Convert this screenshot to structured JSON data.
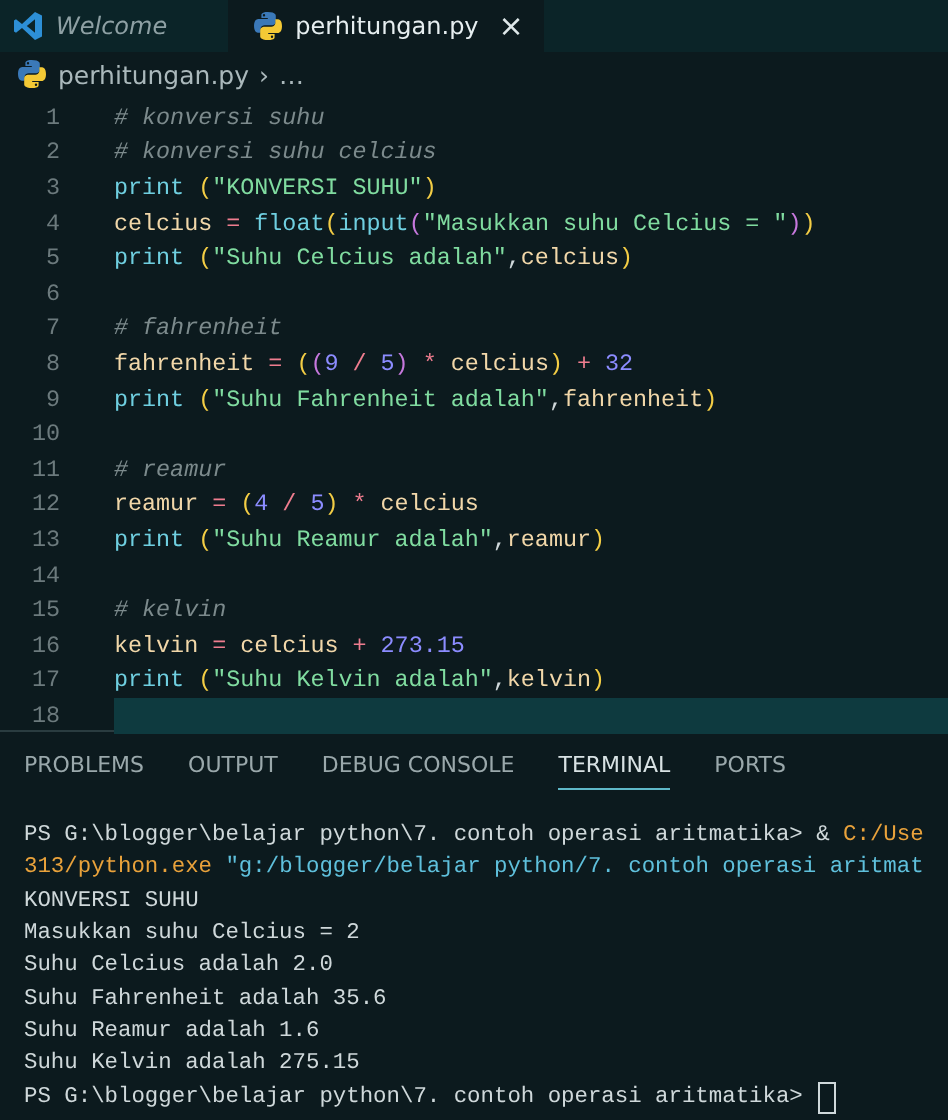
{
  "editor_tabs": [
    {
      "label": "Welcome",
      "kind": "vscode",
      "preview": true,
      "selected": false
    },
    {
      "label": "perhitungan.py",
      "kind": "python",
      "preview": false,
      "selected": true,
      "close": "×"
    }
  ],
  "breadcrumb": {
    "file": "perhitungan.py",
    "separator": "›",
    "more": "…"
  },
  "code_lines": [
    {
      "number": "1",
      "current": false,
      "tokens": [
        {
          "kind": "comment",
          "text": "# konversi suhu"
        }
      ]
    },
    {
      "number": "2",
      "current": false,
      "tokens": [
        {
          "kind": "comment",
          "text": "# konversi suhu celcius"
        }
      ]
    },
    {
      "number": "3",
      "current": false,
      "tokens": [
        {
          "kind": "func",
          "text": "print"
        },
        {
          "kind": "paren1",
          "text": " ("
        },
        {
          "kind": "str",
          "text": "\"KONVERSI SUHU\""
        },
        {
          "kind": "paren1",
          "text": ")"
        }
      ]
    },
    {
      "number": "4",
      "current": false,
      "tokens": [
        {
          "kind": "var",
          "text": "celcius"
        },
        {
          "kind": "op",
          "text": " = "
        },
        {
          "kind": "func",
          "text": "float"
        },
        {
          "kind": "paren1",
          "text": "("
        },
        {
          "kind": "func",
          "text": "input"
        },
        {
          "kind": "paren2",
          "text": "("
        },
        {
          "kind": "str",
          "text": "\"Masukkan suhu Celcius = \""
        },
        {
          "kind": "paren2",
          "text": ")"
        },
        {
          "kind": "paren1",
          "text": ")"
        }
      ]
    },
    {
      "number": "5",
      "current": false,
      "tokens": [
        {
          "kind": "func",
          "text": "print"
        },
        {
          "kind": "paren1",
          "text": " ("
        },
        {
          "kind": "str",
          "text": "\"Suhu Celcius adalah\""
        },
        {
          "kind": "plain",
          "text": ","
        },
        {
          "kind": "var",
          "text": "celcius"
        },
        {
          "kind": "paren1",
          "text": ")"
        }
      ]
    },
    {
      "number": "6",
      "current": false
    },
    {
      "number": "7",
      "current": false,
      "tokens": [
        {
          "kind": "comment",
          "text": "# fahrenheit"
        }
      ]
    },
    {
      "number": "8",
      "current": false,
      "tokens": [
        {
          "kind": "var",
          "text": "fahrenheit"
        },
        {
          "kind": "op",
          "text": " = "
        },
        {
          "kind": "paren1",
          "text": "("
        },
        {
          "kind": "paren2",
          "text": "("
        },
        {
          "kind": "num",
          "text": "9"
        },
        {
          "kind": "op",
          "text": " / "
        },
        {
          "kind": "num",
          "text": "5"
        },
        {
          "kind": "paren2",
          "text": ")"
        },
        {
          "kind": "op",
          "text": " * "
        },
        {
          "kind": "var",
          "text": "celcius"
        },
        {
          "kind": "paren1",
          "text": ")"
        },
        {
          "kind": "op",
          "text": " + "
        },
        {
          "kind": "num",
          "text": "32"
        }
      ]
    },
    {
      "number": "9",
      "current": false,
      "tokens": [
        {
          "kind": "func",
          "text": "print"
        },
        {
          "kind": "paren1",
          "text": " ("
        },
        {
          "kind": "str",
          "text": "\"Suhu Fahrenheit adalah\""
        },
        {
          "kind": "plain",
          "text": ","
        },
        {
          "kind": "var",
          "text": "fahrenheit"
        },
        {
          "kind": "paren1",
          "text": ")"
        }
      ]
    },
    {
      "number": "10",
      "current": false
    },
    {
      "number": "11",
      "current": false,
      "tokens": [
        {
          "kind": "comment",
          "text": "# reamur"
        }
      ]
    },
    {
      "number": "12",
      "current": false,
      "tokens": [
        {
          "kind": "var",
          "text": "reamur"
        },
        {
          "kind": "op",
          "text": " = "
        },
        {
          "kind": "paren1",
          "text": "("
        },
        {
          "kind": "num",
          "text": "4"
        },
        {
          "kind": "op",
          "text": " / "
        },
        {
          "kind": "num",
          "text": "5"
        },
        {
          "kind": "paren1",
          "text": ")"
        },
        {
          "kind": "op",
          "text": " * "
        },
        {
          "kind": "var",
          "text": "celcius"
        }
      ]
    },
    {
      "number": "13",
      "current": false,
      "tokens": [
        {
          "kind": "func",
          "text": "print"
        },
        {
          "kind": "paren1",
          "text": " ("
        },
        {
          "kind": "str",
          "text": "\"Suhu Reamur adalah\""
        },
        {
          "kind": "plain",
          "text": ","
        },
        {
          "kind": "var",
          "text": "reamur"
        },
        {
          "kind": "paren1",
          "text": ")"
        }
      ]
    },
    {
      "number": "14",
      "current": false
    },
    {
      "number": "15",
      "current": false,
      "tokens": [
        {
          "kind": "comment",
          "text": "# kelvin"
        }
      ]
    },
    {
      "number": "16",
      "current": false,
      "tokens": [
        {
          "kind": "var",
          "text": "kelvin"
        },
        {
          "kind": "op",
          "text": " = "
        },
        {
          "kind": "var",
          "text": "celcius"
        },
        {
          "kind": "op",
          "text": " + "
        },
        {
          "kind": "num",
          "text": "273.15"
        }
      ]
    },
    {
      "number": "17",
      "current": false,
      "tokens": [
        {
          "kind": "func",
          "text": "print"
        },
        {
          "kind": "paren1",
          "text": " ("
        },
        {
          "kind": "str",
          "text": "\"Suhu Kelvin adalah\""
        },
        {
          "kind": "plain",
          "text": ","
        },
        {
          "kind": "var",
          "text": "kelvin"
        },
        {
          "kind": "paren1",
          "text": ")"
        }
      ]
    },
    {
      "number": "18",
      "current": true
    }
  ],
  "panel_tabs": [
    {
      "label": "PROBLEMS",
      "selected": false
    },
    {
      "label": "OUTPUT",
      "selected": false
    },
    {
      "label": "DEBUG CONSOLE",
      "selected": false
    },
    {
      "label": "TERMINAL",
      "selected": true
    },
    {
      "label": "PORTS",
      "selected": false
    }
  ],
  "terminal_lines": [
    {
      "cursor": false,
      "tokens": [
        {
          "kind": "plain",
          "text": "PS G:\\blogger\\belajar python\\7. contoh operasi aritmatika> & "
        },
        {
          "kind": "path",
          "text": "C:/Use"
        }
      ]
    },
    {
      "cursor": false,
      "tokens": [
        {
          "kind": "path",
          "text": "313/python.exe "
        },
        {
          "kind": "arg",
          "text": "\"g:/blogger/belajar python/7. contoh operasi aritmat"
        }
      ]
    },
    {
      "cursor": false,
      "tokens": [
        {
          "kind": "plain",
          "text": "KONVERSI SUHU"
        }
      ]
    },
    {
      "cursor": false,
      "tokens": [
        {
          "kind": "plain",
          "text": "Masukkan suhu Celcius = 2"
        }
      ]
    },
    {
      "cursor": false,
      "tokens": [
        {
          "kind": "plain",
          "text": "Suhu Celcius adalah 2.0"
        }
      ]
    },
    {
      "cursor": false,
      "tokens": [
        {
          "kind": "plain",
          "text": "Suhu Fahrenheit adalah 35.6"
        }
      ]
    },
    {
      "cursor": false,
      "tokens": [
        {
          "kind": "plain",
          "text": "Suhu Reamur adalah 1.6"
        }
      ]
    },
    {
      "cursor": false,
      "tokens": [
        {
          "kind": "plain",
          "text": "Suhu Kelvin adalah 275.15"
        }
      ]
    },
    {
      "cursor": true,
      "tokens": [
        {
          "kind": "plain",
          "text": "PS G:\\blogger\\belajar python\\7. contoh operasi aritmatika> "
        }
      ]
    }
  ]
}
